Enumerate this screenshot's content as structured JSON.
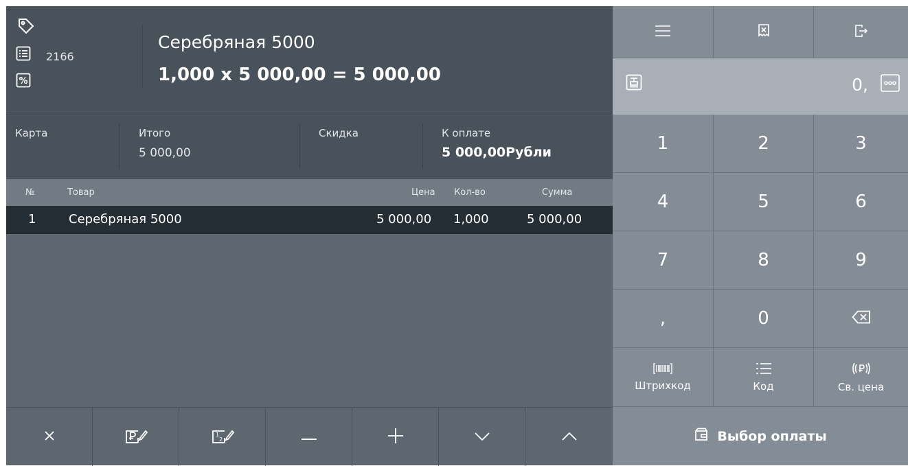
{
  "header": {
    "receipt_number": "2166",
    "item_name": "Серебряная 5000",
    "item_formula": "1,000 x 5 000,00 = 5 000,00"
  },
  "totals": {
    "card_label": "Карта",
    "total_label": "Итого",
    "total_value": "5 000,00",
    "discount_label": "Скидка",
    "pay_label": "К оплате",
    "pay_value": "5 000,00Рубли"
  },
  "table": {
    "columns": [
      "№",
      "Товар",
      "Цена",
      "Кол-во",
      "Сумма"
    ],
    "rows": [
      {
        "num": "1",
        "name": "Серебряная 5000",
        "price": "5 000,00",
        "qty": "1,000",
        "sum": "5 000,00"
      }
    ]
  },
  "bottom_bar": {
    "icons": [
      "close-icon",
      "edit-price-icon",
      "edit-fraction-icon",
      "minus-icon",
      "plus-icon",
      "chevron-down-icon",
      "chevron-up-icon"
    ]
  },
  "keypad": {
    "top_icons": [
      "menu-icon",
      "cancel-receipt-icon",
      "logout-icon"
    ],
    "display_value": "0,",
    "keys": [
      "1",
      "2",
      "3",
      "4",
      "5",
      "6",
      "7",
      "8",
      "9",
      ",",
      "0"
    ],
    "barcode_label": "Штрихкод",
    "code_label": "Код",
    "free_price_label": "Св. цена",
    "pay_button_label": "Выбор оплаты"
  },
  "colors": {
    "header_bg": "#49525b",
    "panel_bg": "#5e6770",
    "selected_row": "#252d35",
    "keypad_bg": "#848c95",
    "display_bg": "#a9afb6"
  }
}
